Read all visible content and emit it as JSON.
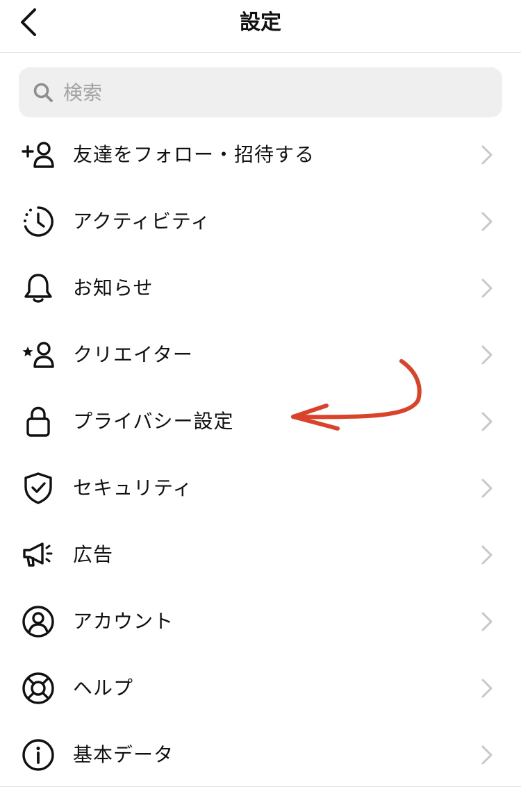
{
  "header": {
    "title": "設定"
  },
  "search": {
    "placeholder": "検索"
  },
  "menu": {
    "items": [
      {
        "label": "友達をフォロー・招待する",
        "icon": "add-person-icon"
      },
      {
        "label": "アクティビティ",
        "icon": "activity-clock-icon"
      },
      {
        "label": "お知らせ",
        "icon": "bell-icon"
      },
      {
        "label": "クリエイター",
        "icon": "creator-star-person-icon"
      },
      {
        "label": "プライバシー設定",
        "icon": "lock-icon"
      },
      {
        "label": "セキュリティ",
        "icon": "shield-check-icon"
      },
      {
        "label": "広告",
        "icon": "megaphone-icon"
      },
      {
        "label": "アカウント",
        "icon": "account-circle-icon"
      },
      {
        "label": "ヘルプ",
        "icon": "lifebuoy-icon"
      },
      {
        "label": "基本データ",
        "icon": "info-icon"
      }
    ]
  },
  "colors": {
    "text": "#111111",
    "chevron": "#c7c7cc",
    "search_bg": "#efefef",
    "placeholder": "#a3a3a3",
    "annotation": "#d9432a"
  }
}
